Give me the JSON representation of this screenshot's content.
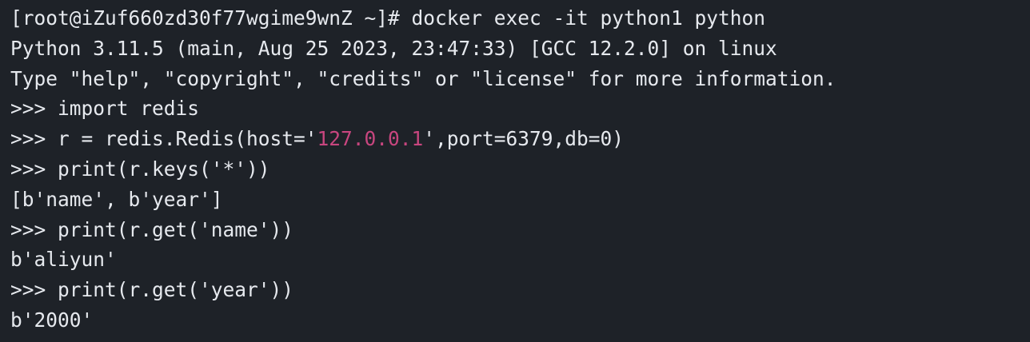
{
  "terminal": {
    "lines": [
      {
        "text": "[root@iZuf660zd30f77wgime9wnZ ~]# docker exec -it python1 python"
      },
      {
        "text": "Python 3.11.5 (main, Aug 25 2023, 23:47:33) [GCC 12.2.0] on linux"
      },
      {
        "text": "Type \"help\", \"copyright\", \"credits\" or \"license\" for more information."
      },
      {
        "text": ">>> import redis"
      },
      {
        "prefix": ">>> r = redis.Redis(host='",
        "highlight": "127.0.0.1",
        "suffix": "',port=6379,db=0)"
      },
      {
        "text": ">>> print(r.keys('*'))"
      },
      {
        "text": "[b'name', b'year']"
      },
      {
        "text": ">>> print(r.get('name'))"
      },
      {
        "text": "b'aliyun'"
      },
      {
        "text": ">>> print(r.get('year'))"
      },
      {
        "text": "b'2000'"
      }
    ]
  },
  "colors": {
    "background": "#1e2228",
    "foreground": "#e6e9ee",
    "string_highlight": "#c8467f"
  }
}
